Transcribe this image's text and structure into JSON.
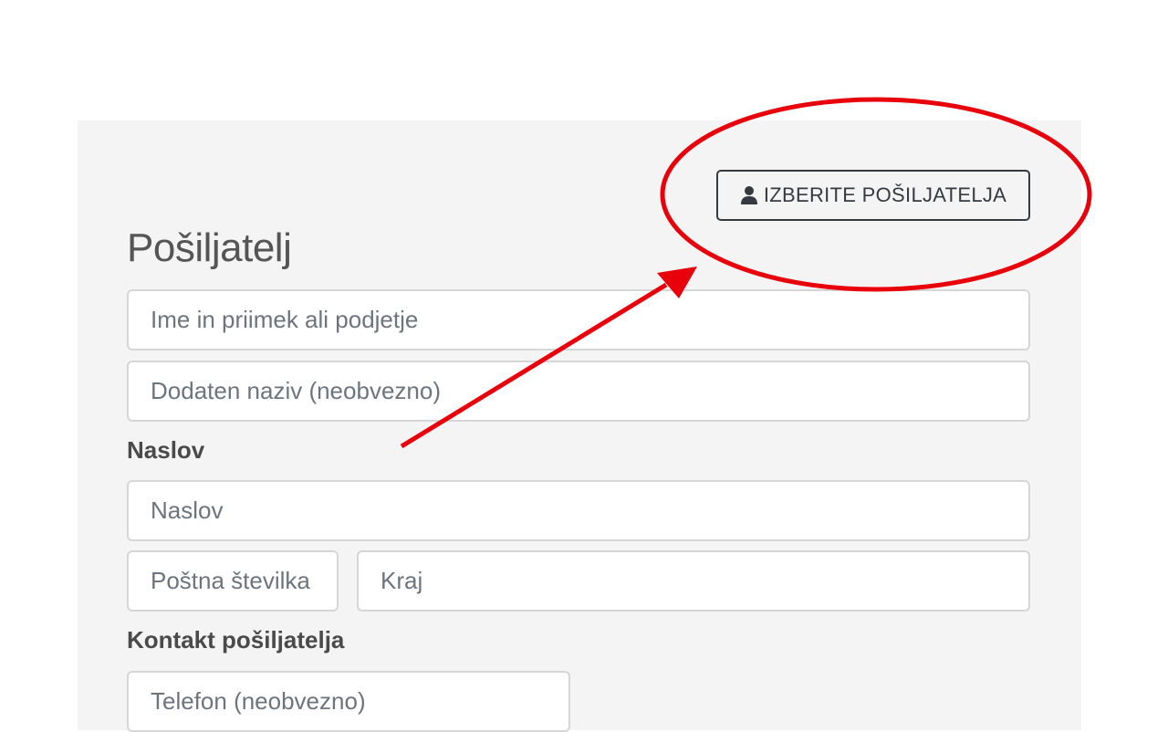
{
  "sender_button": {
    "label": "IZBERITE POŠILJATELJA",
    "icon": "user-icon"
  },
  "section_title": "Pošiljatelj",
  "fields": {
    "name": {
      "placeholder": "Ime in priimek ali podjetje",
      "value": ""
    },
    "extra_name": {
      "placeholder": "Dodaten naziv (neobvezno)",
      "value": ""
    },
    "address": {
      "placeholder": "Naslov",
      "value": ""
    },
    "postal_code": {
      "placeholder": "Poštna številka",
      "value": ""
    },
    "city": {
      "placeholder": "Kraj",
      "value": ""
    },
    "phone": {
      "placeholder": "Telefon (neobvezno)",
      "value": ""
    }
  },
  "labels": {
    "address": "Naslov",
    "contact": "Kontakt pošiljatelja"
  },
  "annotation": {
    "color": "#e8000b",
    "shapes": [
      "ellipse",
      "arrow"
    ]
  }
}
